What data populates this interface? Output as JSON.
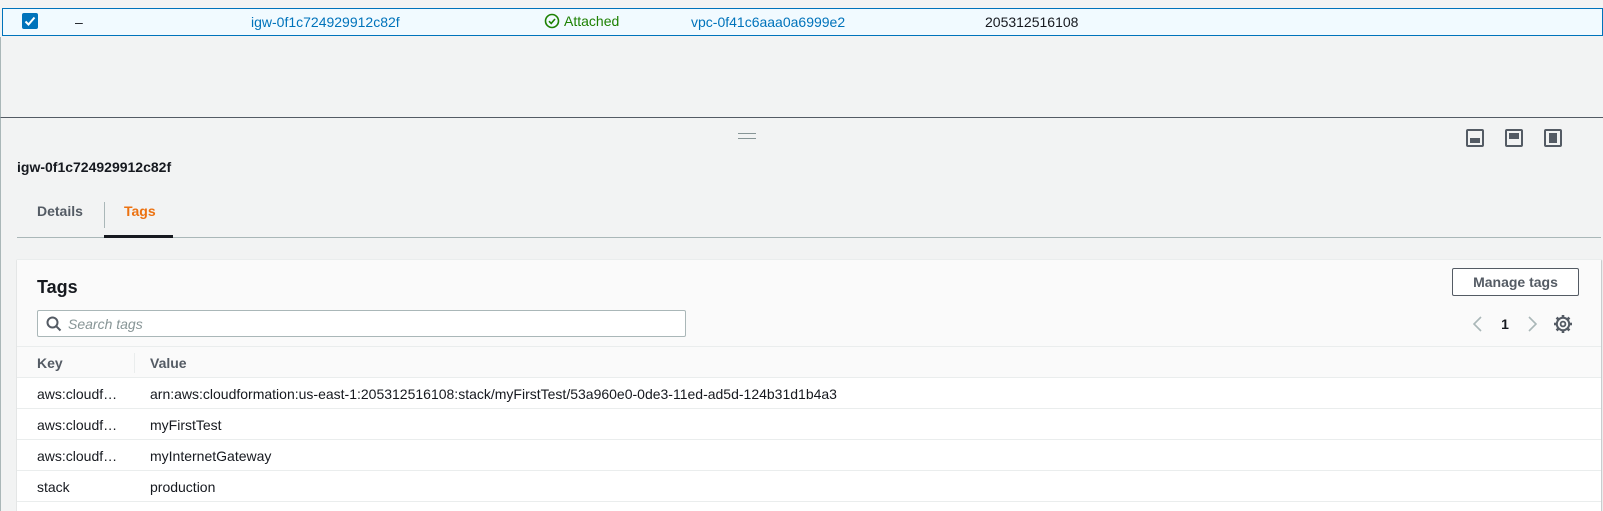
{
  "top_row": {
    "name": "–",
    "id": "igw-0f1c724929912c82f",
    "state": "Attached",
    "vpc_id": "vpc-0f41c6aaa0a6999e2",
    "owner": "205312516108"
  },
  "split_panel": {
    "title": "igw-0f1c724929912c82f",
    "tabs": [
      {
        "label": "Details"
      },
      {
        "label": "Tags"
      }
    ],
    "active_tab": "Tags"
  },
  "tags_section": {
    "title": "Tags",
    "manage_button": "Manage tags",
    "search_placeholder": "Search tags",
    "page": "1",
    "columns": [
      "Key",
      "Value"
    ],
    "rows": [
      {
        "key": "aws:cloudformation:stack-id",
        "key_display": "aws:cloudf…",
        "value": "arn:aws:cloudformation:us-east-1:205312516108:stack/myFirstTest/53a960e0-0de3-11ed-ad5d-124b31d1b4a3"
      },
      {
        "key": "aws:cloudformation:stack-name",
        "key_display": "aws:cloudf…",
        "value": "myFirstTest"
      },
      {
        "key": "aws:cloudformation:logical-id",
        "key_display": "aws:cloudf…",
        "value": "myInternetGateway"
      },
      {
        "key": "stack",
        "key_display": "stack",
        "value": "production"
      }
    ]
  },
  "colors": {
    "link": "#0073bb",
    "success": "#1d8102",
    "active_tab": "#ec7211"
  },
  "icons": [
    "checkbox-checked-icon",
    "status-success-icon",
    "drag-handle-icon",
    "panel-bottom-icon",
    "panel-side-icon",
    "panel-full-icon",
    "search-icon",
    "chevron-left-icon",
    "chevron-right-icon",
    "gear-icon"
  ]
}
